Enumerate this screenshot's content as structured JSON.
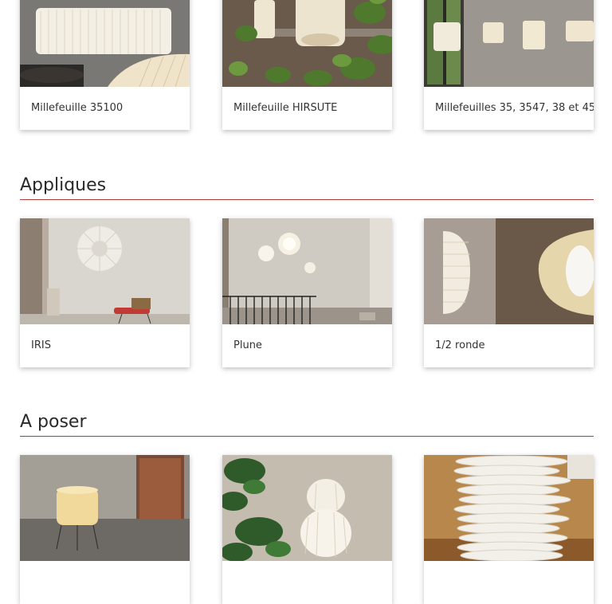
{
  "suspensions": {
    "items": [
      {
        "caption": "Millefeuille 35100"
      },
      {
        "caption": "Millefeuille HIRSUTE"
      },
      {
        "caption": "Millefeuilles 35, 3547, 38 et 45"
      }
    ]
  },
  "appliques": {
    "title": "Appliques",
    "items": [
      {
        "caption": "IRIS"
      },
      {
        "caption": "Plune"
      },
      {
        "caption": "1/2 ronde"
      }
    ]
  },
  "a_poser": {
    "title": "A poser",
    "items": [
      {
        "caption": ""
      },
      {
        "caption": ""
      },
      {
        "caption": ""
      }
    ]
  },
  "colors": {
    "accent": "#b33a3a"
  }
}
